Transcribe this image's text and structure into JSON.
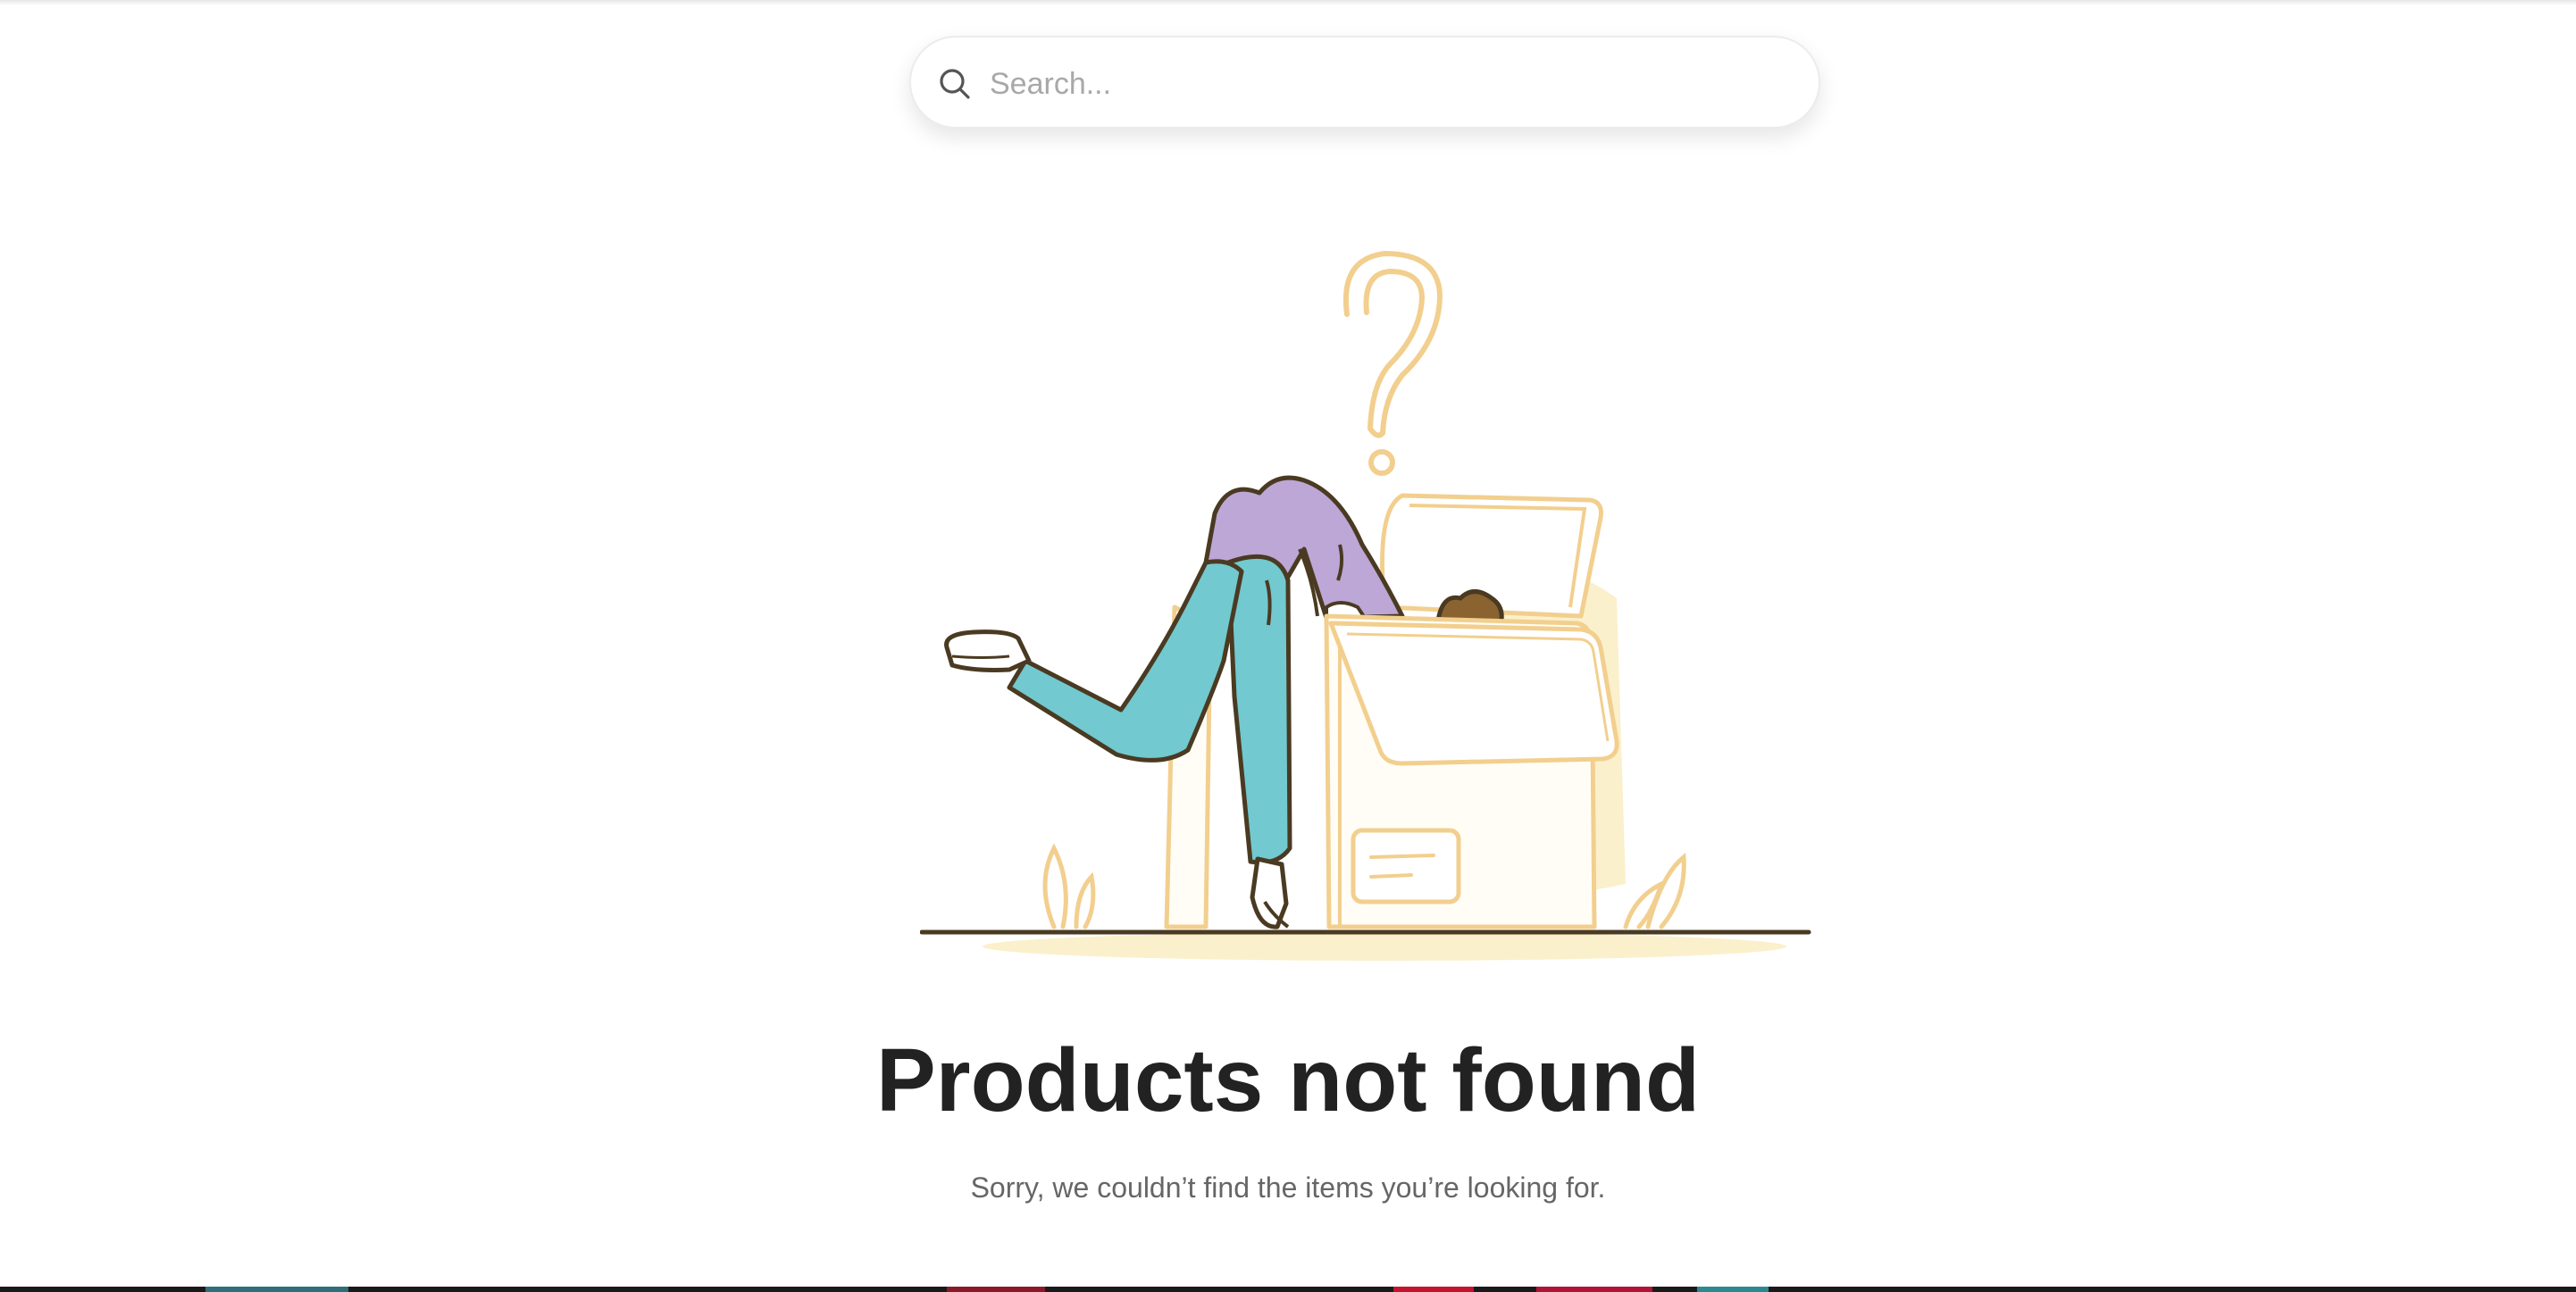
{
  "search": {
    "placeholder": "Search...",
    "value": ""
  },
  "empty_state": {
    "title": "Products not found",
    "subtitle": "Sorry, we couldn’t find the items you’re looking for.",
    "illustration": "person-searching-in-box-illustration"
  },
  "colors": {
    "title": "#222222",
    "subtitle": "#666666",
    "placeholder": "#a8a8a8",
    "box_outline": "#f2cf8e",
    "box_fill": "#fbf0cc",
    "shirt": "#bca7d6",
    "pants": "#72c9d0",
    "ink": "#4a3a22"
  }
}
